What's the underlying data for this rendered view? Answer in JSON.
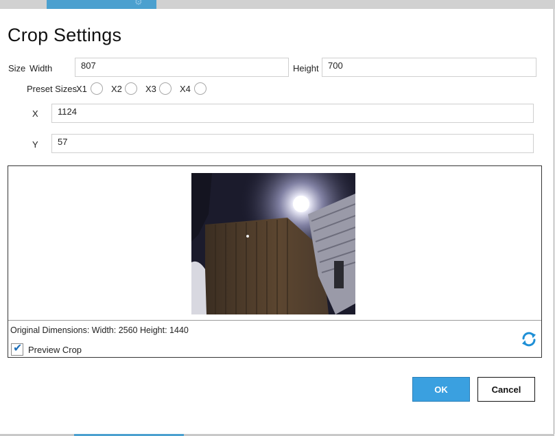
{
  "dialog": {
    "title": "Crop Settings"
  },
  "size": {
    "section_label": "Size",
    "width_label": "Width",
    "width_value": "807",
    "height_label": "Height",
    "height_value": "700"
  },
  "presets": {
    "label": "Preset Sizes",
    "options": [
      "X1",
      "X2",
      "X3",
      "X4"
    ]
  },
  "position": {
    "x_label": "X",
    "x_value": "1124",
    "y_label": "Y",
    "y_value": "57"
  },
  "preview": {
    "original_dimensions": "Original Dimensions: Width: 2560 Height: 1440",
    "preview_crop_label": "Preview Crop",
    "preview_crop_checked": true
  },
  "buttons": {
    "ok": "OK",
    "cancel": "Cancel"
  },
  "colors": {
    "accent": "#3aa0e0",
    "check": "#1e6fb8",
    "refresh": "#1e8fd6"
  },
  "icons": {
    "settings": "gear-icon",
    "refresh": "refresh-icon",
    "check": "checkmark-icon"
  }
}
